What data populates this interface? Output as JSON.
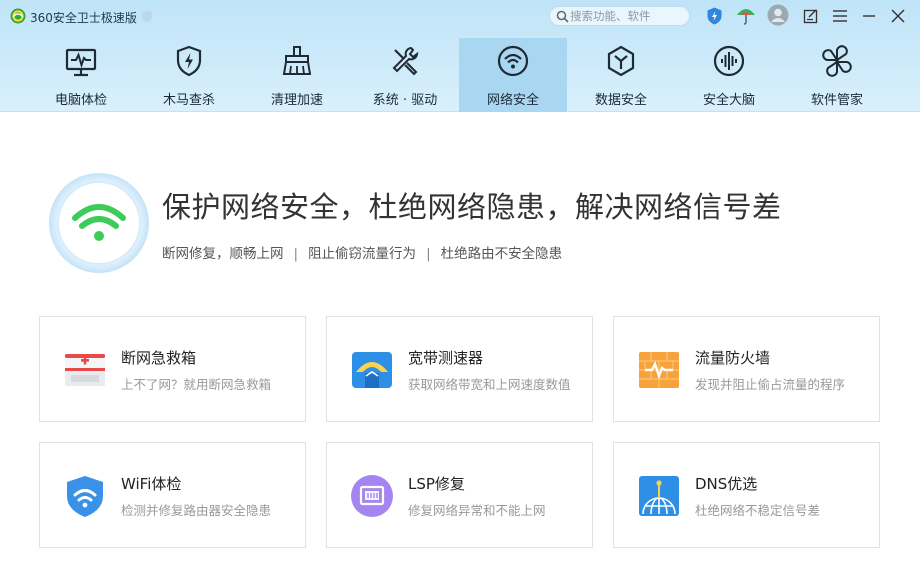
{
  "app": {
    "title": "360安全卫士极速版"
  },
  "search": {
    "placeholder": "搜索功能、软件"
  },
  "nav": {
    "items": [
      {
        "label": "电脑体检",
        "icon": "monitor-pulse-icon"
      },
      {
        "label": "木马查杀",
        "icon": "shield-bolt-icon"
      },
      {
        "label": "清理加速",
        "icon": "broom-icon"
      },
      {
        "label": "系统 · 驱动",
        "icon": "tools-icon"
      },
      {
        "label": "网络安全",
        "icon": "wifi-icon",
        "active": true
      },
      {
        "label": "数据安全",
        "icon": "hexagon-y-icon"
      },
      {
        "label": "安全大脑",
        "icon": "brain-waves-icon"
      },
      {
        "label": "软件管家",
        "icon": "four-leaf-icon"
      }
    ]
  },
  "hero": {
    "title": "保护网络安全，杜绝网络隐患，解决网络信号差",
    "subs": [
      "断网修复，顺畅上网",
      "阻止偷窃流量行为",
      "杜绝路由不安全隐患"
    ],
    "separator": "|"
  },
  "tools": [
    {
      "title": "断网急救箱",
      "desc": "上不了网？就用断网急救箱",
      "icon": "first-aid-box-icon"
    },
    {
      "title": "宽带测速器",
      "desc": "获取网络带宽和上网速度数值",
      "icon": "speed-meter-icon"
    },
    {
      "title": "流量防火墙",
      "desc": "发现并阻止偷占流量的程序",
      "icon": "firewall-icon"
    },
    {
      "title": "WiFi体检",
      "desc": "检测并修复路由器安全隐患",
      "icon": "wifi-shield-icon"
    },
    {
      "title": "LSP修复",
      "desc": "修复网络异常和不能上网",
      "icon": "network-port-icon"
    },
    {
      "title": "DNS优选",
      "desc": "杜绝网络不稳定信号差",
      "icon": "globe-signal-icon"
    }
  ],
  "colors": {
    "accent_green": "#3dcc5a",
    "active_tab": "#a9d6f0",
    "header_top": "#bfe4f7"
  }
}
